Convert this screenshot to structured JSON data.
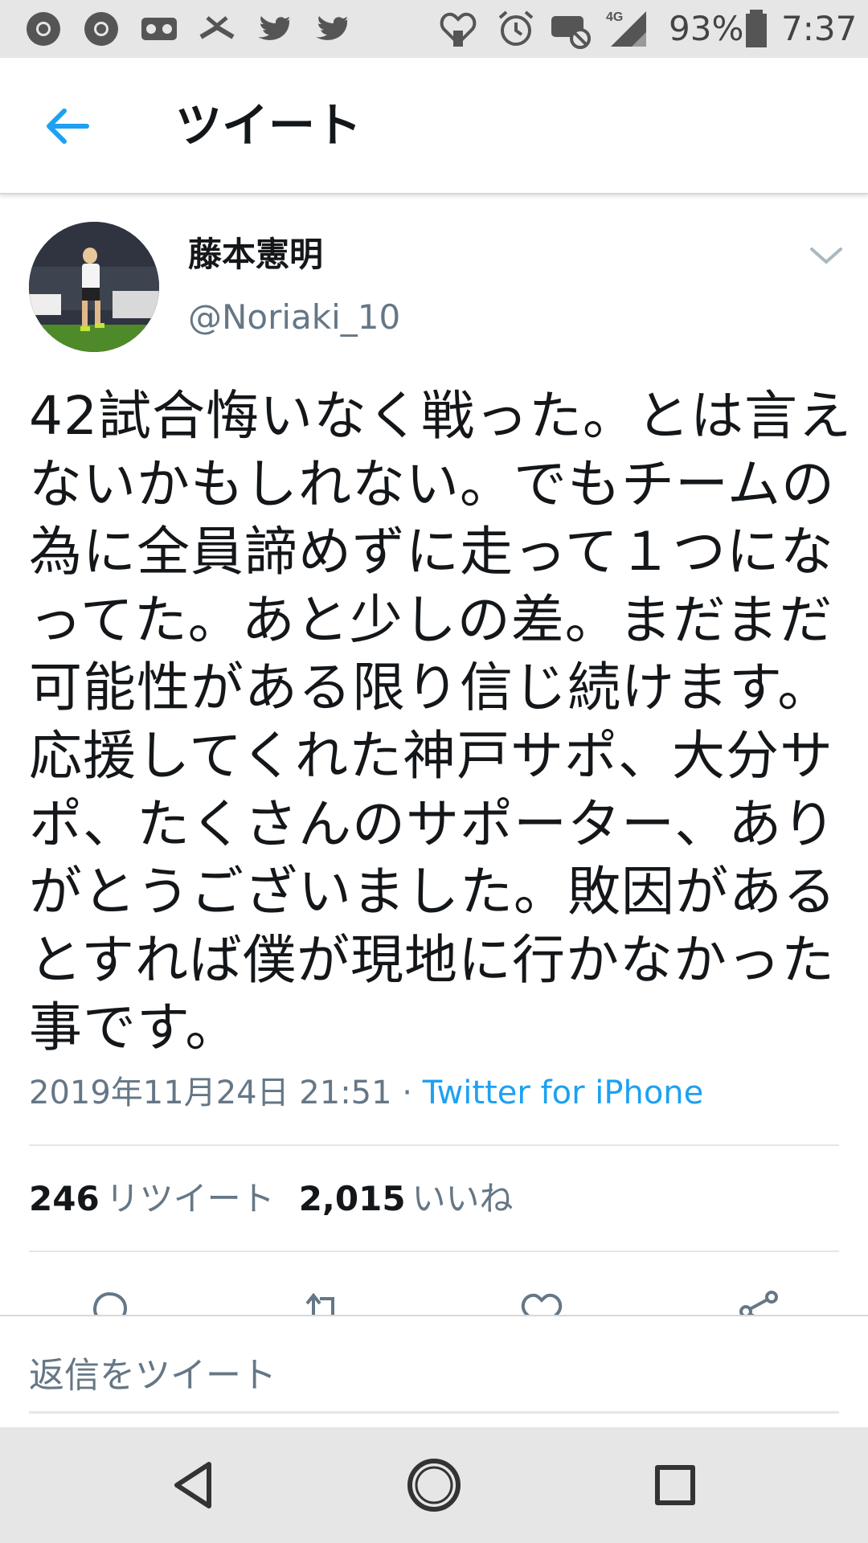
{
  "status_bar": {
    "battery": "93%",
    "network": "4G",
    "time": "7:37"
  },
  "header": {
    "title": "ツイート",
    "back_icon": "arrow-left-icon",
    "accent_color": "#1da1f2"
  },
  "tweet": {
    "display_name": "藤本憲明",
    "handle": "@Noriaki_10",
    "text_lines": [
      "42試合悔いなく戦った。とは言え",
      "ないかもしれない。でもチームの",
      "為に全員諦めずに走って１つにな",
      "ってた。あと少しの差。まだまだ",
      "可能性がある限り信じ続けます。",
      "応援してくれた神戸サポ、大分サ",
      "ポ、たくさんのサポーター、あり",
      "がとうございました。敗因がある",
      "とすれば僕が現地に行かなかった",
      "事です。"
    ],
    "timestamp": "2019年11月24日 21:51",
    "separator": " · ",
    "source": "Twitter for iPhone"
  },
  "stats": {
    "retweets_count": "246",
    "retweets_label": "リツイート",
    "likes_count": "2,015",
    "likes_label": "いいね"
  },
  "reply": {
    "placeholder": "返信をツイート"
  }
}
